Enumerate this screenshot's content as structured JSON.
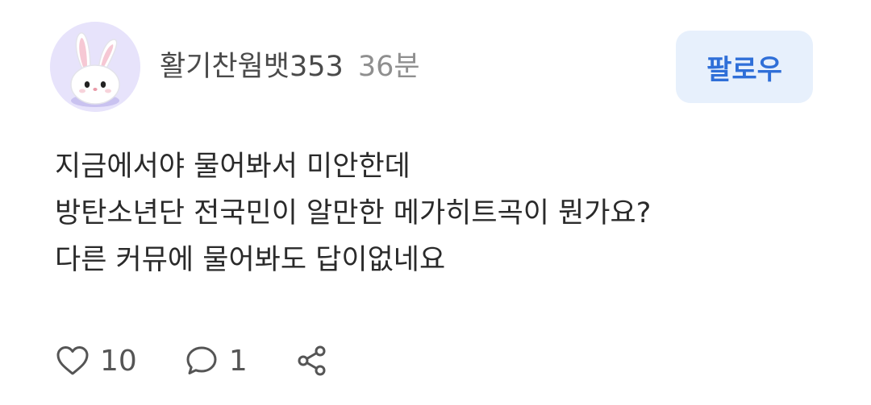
{
  "post": {
    "author": {
      "name": "활기찬웜뱃353",
      "time": "36분",
      "avatar_icon": "bunny-avatar-icon"
    },
    "follow_label": "팔로우",
    "content_lines": [
      "지금에서야 물어봐서 미안한데",
      "방탄소년단 전국민이 알만한 메가히트곡이 뭔가요?",
      "다른 커뮤에 물어봐도 답이없네요"
    ],
    "actions": {
      "likes": {
        "icon": "heart-icon",
        "count": "10"
      },
      "comments": {
        "icon": "comment-icon",
        "count": "1"
      },
      "share": {
        "icon": "share-icon"
      }
    }
  },
  "colors": {
    "follow_bg": "#e7f0fc",
    "follow_text": "#2f6fd8",
    "avatar_bg": "#e7e3fb",
    "meta_gray": "#8f8f8f"
  }
}
